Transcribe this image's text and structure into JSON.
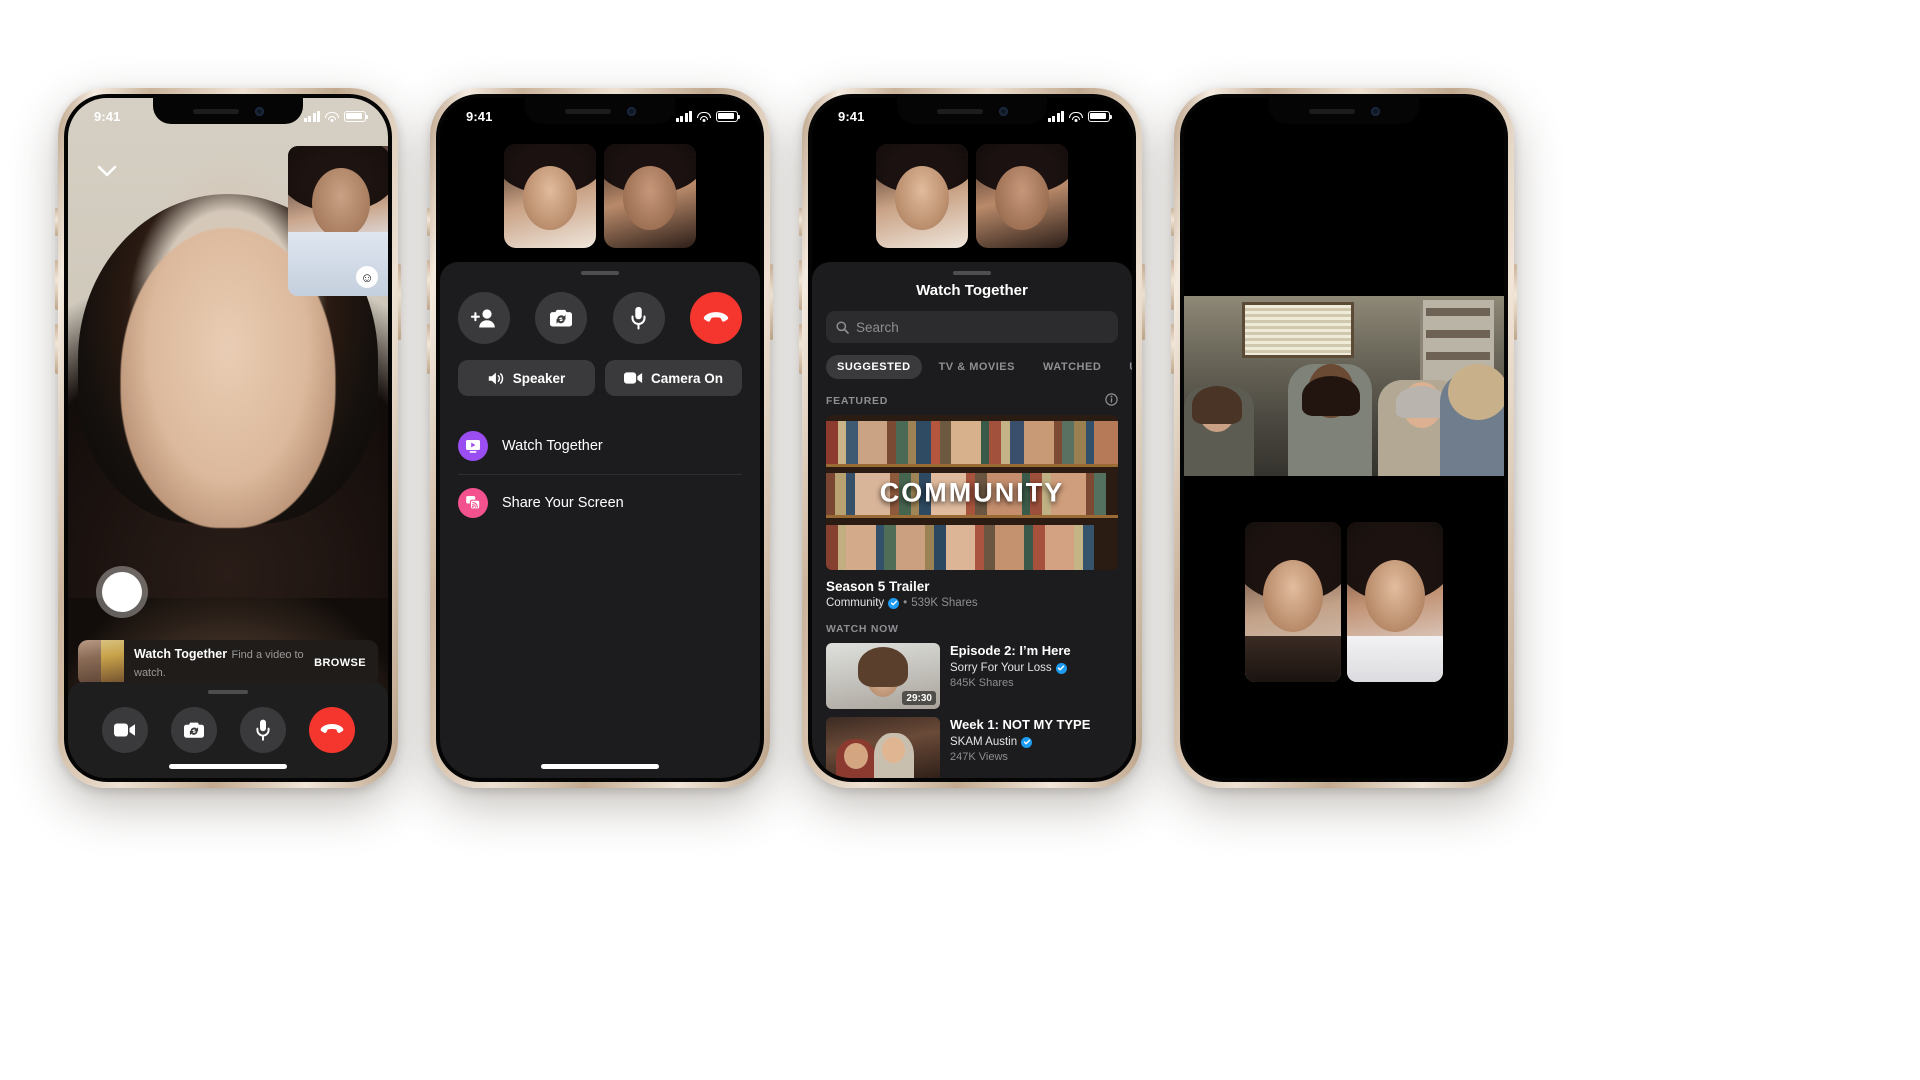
{
  "status_bar": {
    "time": "9:41",
    "signal_icon": "cellular-bars-icon",
    "wifi_icon": "wifi-icon",
    "battery_icon": "battery-icon"
  },
  "phone1": {
    "name": "active-video-call-screen",
    "minimize_icon": "chevron-down-icon",
    "self_view_reaction_icon": "smiley-face-icon",
    "shutter_icon": "capture-button",
    "banner": {
      "title": "Watch Together",
      "subtitle": "Find a video to watch.",
      "action_label": "BROWSE",
      "thumbnail_icon": "video-thumbnail"
    },
    "controls": [
      {
        "name": "video-camera-button",
        "icon": "video-camera-icon"
      },
      {
        "name": "flip-camera-button",
        "icon": "camera-flip-icon"
      },
      {
        "name": "microphone-button",
        "icon": "microphone-icon"
      },
      {
        "name": "end-call-button",
        "icon": "phone-hangup-icon"
      }
    ]
  },
  "phone2": {
    "name": "call-options-sheet-screen",
    "participants": [
      {
        "name": "participant-tile-1"
      },
      {
        "name": "participant-tile-2"
      }
    ],
    "round_controls": [
      {
        "name": "add-person-button",
        "icon": "add-person-icon"
      },
      {
        "name": "flip-camera-button",
        "icon": "camera-flip-icon"
      },
      {
        "name": "microphone-button",
        "icon": "microphone-icon"
      },
      {
        "name": "end-call-button",
        "icon": "phone-hangup-icon"
      }
    ],
    "toggles": [
      {
        "label": "Speaker",
        "icon": "speaker-icon",
        "name": "speaker-toggle"
      },
      {
        "label": "Camera On",
        "icon": "video-camera-icon",
        "name": "camera-toggle"
      }
    ],
    "menu_items": [
      {
        "label": "Watch Together",
        "icon": "watch-together-icon",
        "color": "#9a4df0",
        "name": "watch-together-menu-item"
      },
      {
        "label": "Share Your Screen",
        "icon": "screen-share-icon",
        "color": "#f4528f",
        "name": "share-screen-menu-item"
      }
    ]
  },
  "phone3": {
    "name": "watch-together-browser-screen",
    "title": "Watch Together",
    "search": {
      "placeholder": "Search",
      "value": "",
      "icon": "search-icon"
    },
    "tabs": [
      {
        "label": "SUGGESTED",
        "active": true
      },
      {
        "label": "TV & MOVIES",
        "active": false
      },
      {
        "label": "WATCHED",
        "active": false
      },
      {
        "label": "U",
        "active": false
      }
    ],
    "featured": {
      "section_label": "FEATURED",
      "info_icon": "info-circle-icon",
      "poster_text": "COMMUNITY",
      "title": "Season 5 Trailer",
      "channel": "Community",
      "verified": true,
      "stats": "539K Shares",
      "separator": "•"
    },
    "watch_now": {
      "section_label": "WATCH NOW",
      "items": [
        {
          "title": "Episode 2: I’m Here",
          "channel": "Sorry For Your Loss",
          "verified": true,
          "stats": "845K Shares",
          "duration": "29:30"
        },
        {
          "title": "Week 1: NOT MY TYPE",
          "channel": "SKAM Austin",
          "verified": true,
          "stats": "247K Views",
          "duration": ""
        }
      ]
    }
  },
  "phone4": {
    "name": "co-watching-playback-screen",
    "video_name": "shared-video-player",
    "participants": [
      {
        "name": "participant-pip-1"
      },
      {
        "name": "participant-pip-2"
      }
    ]
  },
  "colors": {
    "accent_purple": "#9a4df0",
    "accent_pink": "#f4528f",
    "end_call_red": "#f5362f",
    "verified_blue": "#1d9bf0",
    "sheet_bg": "#1c1c1e",
    "control_bg": "#3a3a3c",
    "muted_text": "#8e8e93"
  }
}
